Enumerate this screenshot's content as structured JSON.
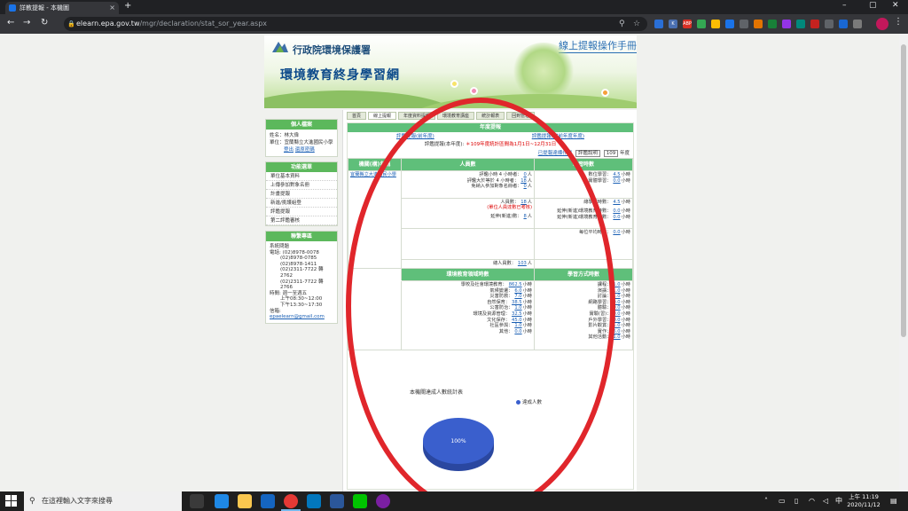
{
  "browser": {
    "tab_title": "詳教提報 - 本機圖",
    "url_host": "elearn.epa.gov.tw",
    "url_path": "/mgr/declaration/stat_sor_year.aspx",
    "new_tab": "+",
    "win_min": "–",
    "win_max": "▢",
    "win_close": "✕",
    "back": "←",
    "forward": "→",
    "reload": "↻"
  },
  "banner": {
    "agency": "行政院環境保護署",
    "site_name": "環境教育終身學習網",
    "manual_link": "線上提報操作手冊"
  },
  "sidebar": {
    "personal": {
      "title": "個人檔案",
      "name_label": "姓名：",
      "name": "林大偉",
      "unit_label": "單位：",
      "unit": "宜蘭縣立大進國民小學",
      "logout": "登出",
      "change_password": "還原密碼"
    },
    "functions": {
      "title": "功能選單",
      "items": [
        "單位基本資料",
        "上傳參加對象名冊",
        "計畫提報",
        "新進/挑護組登",
        "評鑑提報",
        "第二評鑑審核"
      ]
    },
    "contact": {
      "title": "聯繫專區",
      "lines": [
        "系統問題",
        "電話: (02)8978-0078",
        "(02)8978-0785",
        "(02)8978-1411",
        "(02)2311-7722 轉2762",
        "(02)2311-7722 轉2766",
        "時間: 週一至週五",
        "上午08:30~12:00",
        "下午13:30~17:30"
      ],
      "email_label": "信箱:",
      "email": "epaelearn@gmail.com"
    }
  },
  "nav_tabs": [
    "首頁",
    "線上提報",
    "年度資料提報",
    "環境教育講座",
    "統計報表",
    "回到管理"
  ],
  "content": {
    "section_title": "年度提報",
    "link_left": "評鑑提報(前年度)",
    "link_right": "評鑑提報(當前年度年度)",
    "note_prefix": "評鑑提報(本年度):",
    "note_red": "＊109年度統計區間為1月1日~12月31日",
    "unit_link": "已提報達標作業",
    "unit_select": "評鑑說明",
    "year_select": "109",
    "year_suffix": "年度",
    "table_headers": [
      "機關(構)名稱",
      "人員數",
      "學習時數"
    ],
    "unit_name": "宜蘭縣立大進國民小學",
    "people_rows": [
      {
        "k": "評鑑小時 4 小時者：",
        "v": "0",
        "u": "人"
      },
      {
        "k": "評鑑大於等於 4 小時者：",
        "v": "18",
        "u": "人"
      },
      {
        "k": "免納入參加對象名冊者：",
        "v": "0",
        "u": "人"
      }
    ],
    "people_count": {
      "k": "人員數：",
      "v": "18",
      "u": "人"
    },
    "people_red": "(單位人員達數已考核)",
    "leave_count": {
      "k": "延伸(新進)數：",
      "v": "8",
      "u": "人"
    },
    "total_count": {
      "k": "總人員數：",
      "v": "103",
      "u": "人"
    },
    "hours_rows": [
      {
        "k": "數位學習：",
        "v": "4.5",
        "u": "小時"
      },
      {
        "k": "實體學習：",
        "v": "0.0",
        "u": "小時"
      }
    ],
    "hours_total": {
      "k": "總學習時數：",
      "v": "4.5",
      "u": "小時"
    },
    "hours_extra": [
      {
        "k": "延伸(新進)環境教育時數：",
        "v": "0.0",
        "u": "小時"
      },
      {
        "k": "延伸(新進)環境教育時數：",
        "v": "0.0",
        "u": "小時"
      }
    ],
    "hours_avg": {
      "k": "每位平均時數：",
      "v": "0.0",
      "u": "小時"
    },
    "sub_headers": [
      "環境教育領域時數",
      "學習方式時數"
    ],
    "domain_rows": [
      {
        "k": "學校及社會環境教育：",
        "v": "862.5",
        "u": "小時"
      },
      {
        "k": "氣候變遷：",
        "v": "6.0",
        "u": "小時"
      },
      {
        "k": "災害防救：",
        "v": "7.0",
        "u": "小時"
      },
      {
        "k": "自然保育：",
        "v": "38.5",
        "u": "小時"
      },
      {
        "k": "公害防治：",
        "v": "1.0",
        "u": "小時"
      },
      {
        "k": "環境及資源管理：",
        "v": "32.5",
        "u": "小時"
      },
      {
        "k": "文化保存：",
        "v": "45.0",
        "u": "小時"
      },
      {
        "k": "社區參與：",
        "v": "1.0",
        "u": "小時"
      },
      {
        "k": "其他：",
        "v": "0.0",
        "u": "小時"
      }
    ],
    "method_rows": [
      {
        "k": "課程：",
        "v": "1.0",
        "u": "小時"
      },
      {
        "k": "演講：",
        "v": "1.0",
        "u": "小時"
      },
      {
        "k": "討論：",
        "v": "1.0",
        "u": "小時"
      },
      {
        "k": "網路學習：",
        "v": "0.0",
        "u": "小時"
      },
      {
        "k": "體驗：",
        "v": "0.0",
        "u": "小時"
      },
      {
        "k": "實驗(習)：",
        "v": "0.0",
        "u": "小時"
      },
      {
        "k": "戶外學習：",
        "v": "0.0",
        "u": "小時"
      },
      {
        "k": "影片觀賞：",
        "v": "1.0",
        "u": "小時"
      },
      {
        "k": "實作：",
        "v": "6.0",
        "u": "小時"
      },
      {
        "k": "其他活動：",
        "v": "1.0",
        "u": "小時"
      }
    ]
  },
  "chart_data": {
    "type": "pie",
    "title": "本機關達成人數統計表",
    "categories": [
      "達成人數"
    ],
    "values": [
      100
    ],
    "labels": [
      "100%"
    ],
    "colors": [
      "#3a5fcd"
    ],
    "legend_position": "top-right"
  },
  "taskbar": {
    "search_placeholder": "在這裡輸入文字來搜尋",
    "time": "上午 11:19",
    "date": "2020/11/12",
    "lang": "中"
  }
}
